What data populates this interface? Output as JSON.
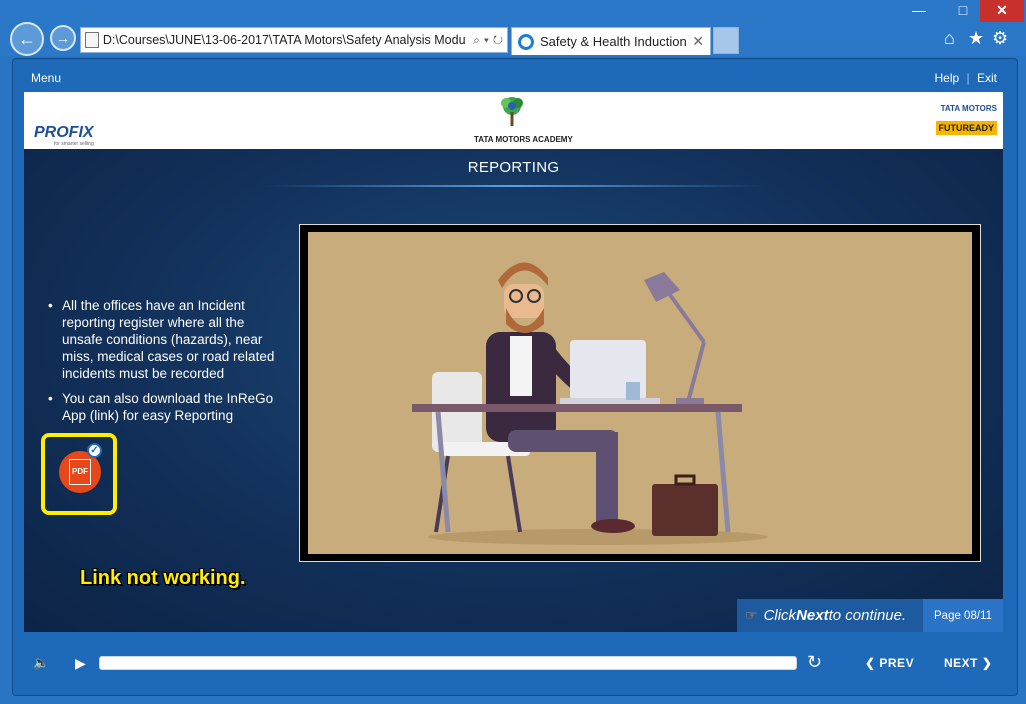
{
  "browser": {
    "address": "D:\\Courses\\JUNE\\13-06-2017\\TATA Motors\\Safety Analysis Modu",
    "tab_title": "Safety & Health Induction",
    "controls": {
      "minimize": "—",
      "maximize": "□",
      "close": "✕"
    }
  },
  "player": {
    "menu_label": "Menu",
    "help_label": "Help",
    "exit_label": "Exit",
    "separator": "|"
  },
  "banner": {
    "profix": "PROFIX",
    "profix_tagline": "for smarter selling",
    "academy": "TATA MOTORS ACADEMY",
    "tata_motors": "TATA MOTORS",
    "futuready": "FUTUREADY"
  },
  "slide": {
    "title": "REPORTING",
    "bullets": [
      "All the offices have an Incident reporting register where all the unsafe conditions (hazards), near miss, medical cases or road related incidents must be recorded",
      "You can also download the InReGo App (link) for easy Reporting"
    ],
    "pdf_label": "PDF",
    "annotation": "Link not working.",
    "click_next_prefix": "Click ",
    "click_next_bold": "Next",
    "click_next_suffix": " to continue.",
    "page_number": "Page 08/11"
  },
  "controls": {
    "prev_label": "PREV",
    "next_label": "NEXT",
    "progress": 0
  },
  "colors": {
    "chrome_blue": "#2b78c9",
    "player_blue": "#1e6ab8",
    "highlight_yellow": "#ffee00",
    "pdf_orange": "#e8471a",
    "illustration_bg": "#c9ac7c"
  }
}
